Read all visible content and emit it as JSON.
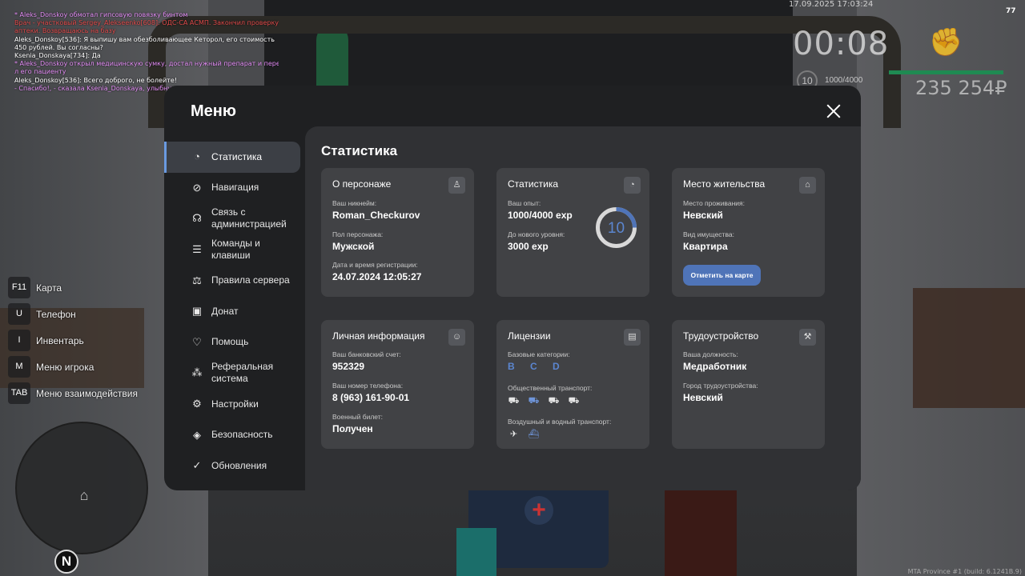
{
  "chat": [
    {
      "cls": "c-pink",
      "text": "* Aleks_Donskoy обмотал гипсовую повязку бинтом"
    },
    {
      "cls": "c-red",
      "text": "Врач - участковый Sergey_Alekseenko[608]: ОДС-СА АСМП. Закончил проверку"
    },
    {
      "cls": "c-red",
      "text": " аптеки. Возвращаюсь на базу"
    },
    {
      "cls": "c-white",
      "text": "Aleks_Donskoy[536]: Я выпишу вам обезболивающее Кеторол, его стоимость"
    },
    {
      "cls": "c-white",
      "text": " 450 рублей. Вы согласны?"
    },
    {
      "cls": "c-white",
      "text": "Ksenia_Donskaya[734]: Да"
    },
    {
      "cls": "c-pink",
      "text": "* Aleks_Donskoy открыл медицинскую сумку, достал нужный препарат и переда"
    },
    {
      "cls": "c-pink",
      "text": "л его пациенту"
    },
    {
      "cls": "c-white",
      "text": "Aleks_Donskoy[536]: Всего доброго, не болейте!"
    },
    {
      "cls": "c-pink",
      "text": "- Спасибо!, - сказала Ksenia_Donskaya, улыбнувшись."
    }
  ],
  "hud": {
    "datetime": "17.09.2025 17:03:24",
    "fps": "77",
    "timer": "00:08",
    "level": "10",
    "exp": "1000/4000",
    "money": "235 254₽",
    "fist_icon": "fist-icon"
  },
  "binds": [
    {
      "key": "F11",
      "label": "Карта"
    },
    {
      "key": "U",
      "label": "Телефон"
    },
    {
      "key": "I",
      "label": "Инвентарь"
    },
    {
      "key": "M",
      "label": "Меню игрока"
    },
    {
      "key": "TAB",
      "label": "Меню взаимодействия"
    }
  ],
  "minimap": {
    "north": "N"
  },
  "build": "MTA Province #1 (build: 6.1241B.9)",
  "menu": {
    "title": "Меню",
    "nav": [
      {
        "icon": "◔",
        "label": "Статистика",
        "active": true
      },
      {
        "icon": "⊘",
        "label": "Навигация"
      },
      {
        "icon": "☊",
        "label": "Связь с администрацией"
      },
      {
        "icon": "☰",
        "label": "Команды и клавиши"
      },
      {
        "icon": "⚖",
        "label": "Правила сервера"
      },
      {
        "icon": "▣",
        "label": "Донат"
      },
      {
        "icon": "♡",
        "label": "Помощь"
      },
      {
        "icon": "⁂",
        "label": "Реферальная система"
      },
      {
        "icon": "⚙",
        "label": "Настройки"
      },
      {
        "icon": "◈",
        "label": "Безопасность"
      },
      {
        "icon": "✓",
        "label": "Обновления"
      }
    ],
    "panel_title": "Статистика",
    "character": {
      "title": "О персонаже",
      "nick_label": "Ваш никнейм:",
      "nick": "Roman_Checkurov",
      "gender_label": "Пол персонажа:",
      "gender": "Мужской",
      "reg_label": "Дата и время регистрации:",
      "reg": "24.07.2024 12:05:27"
    },
    "stats": {
      "title": "Статистика",
      "exp_label": "Ваш опыт:",
      "exp": "1000/4000 exp",
      "next_label": "До нового уровня:",
      "next": "3000 exp",
      "level": "10",
      "progress": 0.25
    },
    "residence": {
      "title": "Место жительства",
      "place_label": "Место проживания:",
      "place": "Невский",
      "type_label": "Вид имущества:",
      "type": "Квартира",
      "button": "Отметить на карте"
    },
    "personal": {
      "title": "Личная информация",
      "bank_label": "Ваш банковский счет:",
      "bank": "952329",
      "phone_label": "Ваш номер телефона:",
      "phone": "8 (963) 161-90-01",
      "military_label": "Военный билет:",
      "military": "Получен"
    },
    "licenses": {
      "title": "Лицензии",
      "base_label": "Базовые категории:",
      "base": "B C D",
      "public_label": "Общественный транспорт:",
      "air_label": "Воздушный и водный транспорт:"
    },
    "employment": {
      "title": "Трудоустройство",
      "post_label": "Ваша должность:",
      "post": "Медработник",
      "city_label": "Город трудоустройства:",
      "city": "Невский"
    }
  }
}
